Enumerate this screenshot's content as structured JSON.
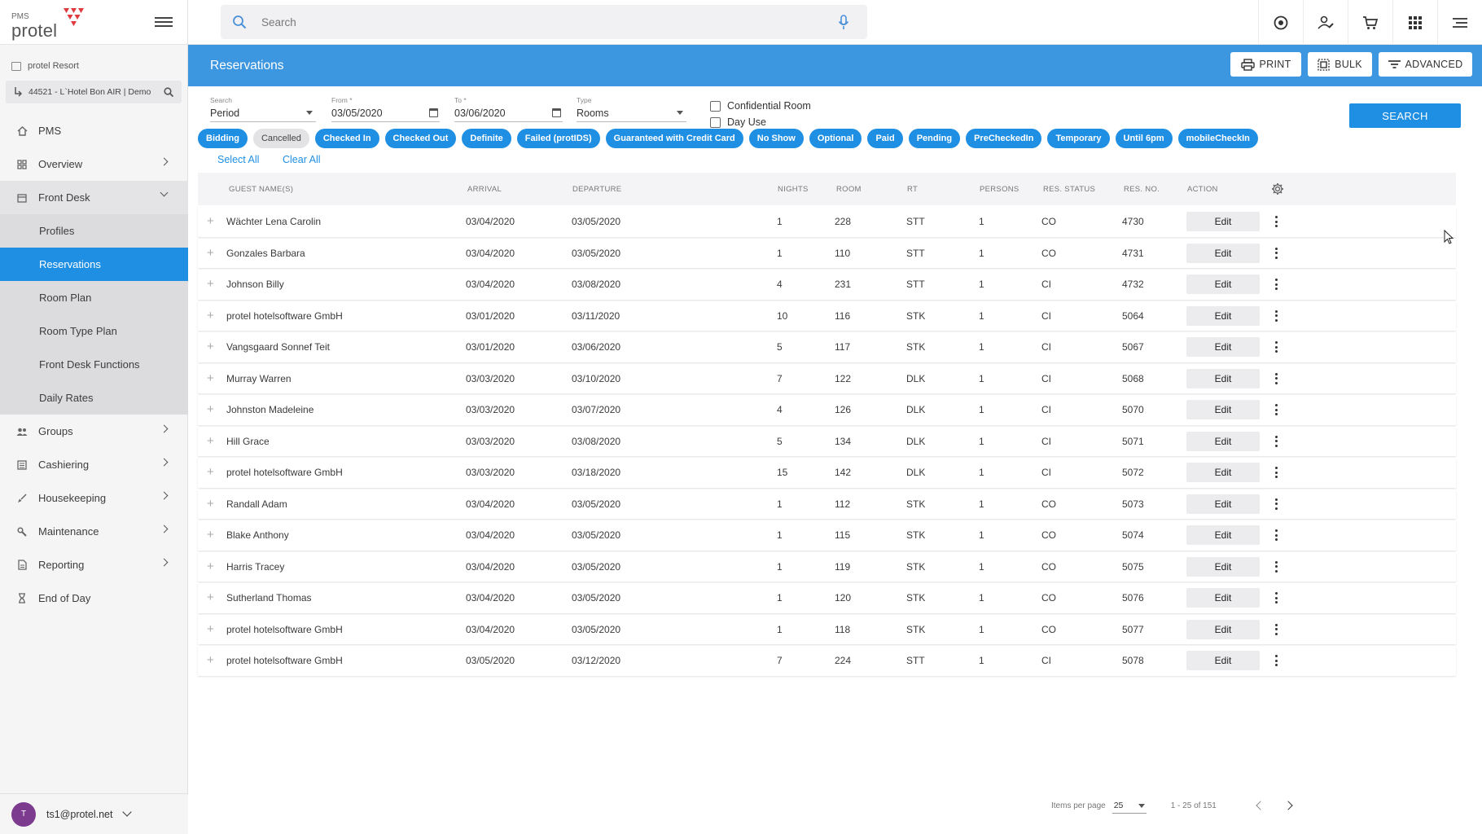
{
  "brand": {
    "pms": "PMS",
    "logo": "protel"
  },
  "property": {
    "resort": "protel Resort",
    "hotel": "44521 - L`Hotel  Bon AIR | Demo"
  },
  "nav": {
    "items": [
      {
        "label": "PMS",
        "icon": "home-icon"
      },
      {
        "label": "Overview",
        "icon": "dashboard-icon"
      },
      {
        "label": "Front Desk",
        "icon": "calendar-icon"
      }
    ],
    "front_desk_sub": [
      "Profiles",
      "Reservations",
      "Room Plan",
      "Room Type Plan",
      "Front Desk Functions",
      "Daily Rates"
    ],
    "more": [
      {
        "label": "Groups",
        "icon": "group-icon"
      },
      {
        "label": "Cashiering",
        "icon": "ledger-icon"
      },
      {
        "label": "Housekeeping",
        "icon": "broom-icon"
      },
      {
        "label": "Maintenance",
        "icon": "wrench-icon"
      },
      {
        "label": "Reporting",
        "icon": "report-icon"
      },
      {
        "label": "End of Day",
        "icon": "hourglass-icon"
      }
    ]
  },
  "user": {
    "initial": "T",
    "email": "ts1@protel.net"
  },
  "search": {
    "placeholder": "Search"
  },
  "header": {
    "title": "Reservations",
    "print": "PRINT",
    "bulk": "BULK",
    "advanced": "ADVANCED"
  },
  "filters": {
    "search_label": "Search",
    "search_value": "Period",
    "from_label": "From *",
    "from_value": "03/05/2020",
    "to_label": "To *",
    "to_value": "03/06/2020",
    "type_label": "Type",
    "type_value": "Rooms",
    "confidential": "Confidential Room",
    "day_use": "Day Use",
    "search_button": "SEARCH",
    "select_all": "Select All",
    "clear_all": "Clear All"
  },
  "status_chips": [
    {
      "label": "Bidding",
      "on": true
    },
    {
      "label": "Cancelled",
      "on": false
    },
    {
      "label": "Checked In",
      "on": true
    },
    {
      "label": "Checked Out",
      "on": true
    },
    {
      "label": "Definite",
      "on": true
    },
    {
      "label": "Failed (protIDS)",
      "on": true
    },
    {
      "label": "Guaranteed with Credit Card",
      "on": true
    },
    {
      "label": "No Show",
      "on": true
    },
    {
      "label": "Optional",
      "on": true
    },
    {
      "label": "Paid",
      "on": true
    },
    {
      "label": "Pending",
      "on": true
    },
    {
      "label": "PreCheckedIn",
      "on": true
    },
    {
      "label": "Temporary",
      "on": true
    },
    {
      "label": "Until 6pm",
      "on": true
    },
    {
      "label": "mobileCheckIn",
      "on": true
    }
  ],
  "table": {
    "columns": [
      "GUEST NAME(S)",
      "ARRIVAL",
      "DEPARTURE",
      "NIGHTS",
      "ROOM",
      "RT",
      "PERSONS",
      "RES. STATUS",
      "RES. NO.",
      "ACTION"
    ],
    "edit_label": "Edit",
    "rows": [
      [
        "Wächter Lena Carolin",
        "03/04/2020",
        "03/05/2020",
        "1",
        "228",
        "STT",
        "1",
        "CO",
        "4730"
      ],
      [
        "Gonzales Barbara",
        "03/04/2020",
        "03/05/2020",
        "1",
        "110",
        "STT",
        "1",
        "CO",
        "4731"
      ],
      [
        "Johnson Billy",
        "03/04/2020",
        "03/08/2020",
        "4",
        "231",
        "STT",
        "1",
        "CI",
        "4732"
      ],
      [
        "protel hotelsoftware GmbH",
        "03/01/2020",
        "03/11/2020",
        "10",
        "116",
        "STK",
        "1",
        "CI",
        "5064"
      ],
      [
        "Vangsgaard Sonnef Teit",
        "03/01/2020",
        "03/06/2020",
        "5",
        "117",
        "STK",
        "1",
        "CI",
        "5067"
      ],
      [
        "Murray Warren",
        "03/03/2020",
        "03/10/2020",
        "7",
        "122",
        "DLK",
        "1",
        "CI",
        "5068"
      ],
      [
        "Johnston Madeleine",
        "03/03/2020",
        "03/07/2020",
        "4",
        "126",
        "DLK",
        "1",
        "CI",
        "5070"
      ],
      [
        "Hill Grace",
        "03/03/2020",
        "03/08/2020",
        "5",
        "134",
        "DLK",
        "1",
        "CI",
        "5071"
      ],
      [
        "protel hotelsoftware GmbH",
        "03/03/2020",
        "03/18/2020",
        "15",
        "142",
        "DLK",
        "1",
        "CI",
        "5072"
      ],
      [
        "Randall Adam",
        "03/04/2020",
        "03/05/2020",
        "1",
        "112",
        "STK",
        "1",
        "CO",
        "5073"
      ],
      [
        "Blake Anthony",
        "03/04/2020",
        "03/05/2020",
        "1",
        "115",
        "STK",
        "1",
        "CO",
        "5074"
      ],
      [
        "Harris Tracey",
        "03/04/2020",
        "03/05/2020",
        "1",
        "119",
        "STK",
        "1",
        "CO",
        "5075"
      ],
      [
        "Sutherland Thomas",
        "03/04/2020",
        "03/05/2020",
        "1",
        "120",
        "STK",
        "1",
        "CO",
        "5076"
      ],
      [
        "protel hotelsoftware GmbH",
        "03/04/2020",
        "03/05/2020",
        "1",
        "118",
        "STK",
        "1",
        "CO",
        "5077"
      ],
      [
        "protel hotelsoftware GmbH",
        "03/05/2020",
        "03/12/2020",
        "7",
        "224",
        "STT",
        "1",
        "CI",
        "5078"
      ]
    ]
  },
  "pagination": {
    "items_per_page_label": "Items per page",
    "items_per_page": "25",
    "range": "1 - 25 of 151"
  },
  "colors": {
    "accent": "#1f8fe3",
    "band": "#3d96e0",
    "logo_mark": "#e03a3e"
  }
}
